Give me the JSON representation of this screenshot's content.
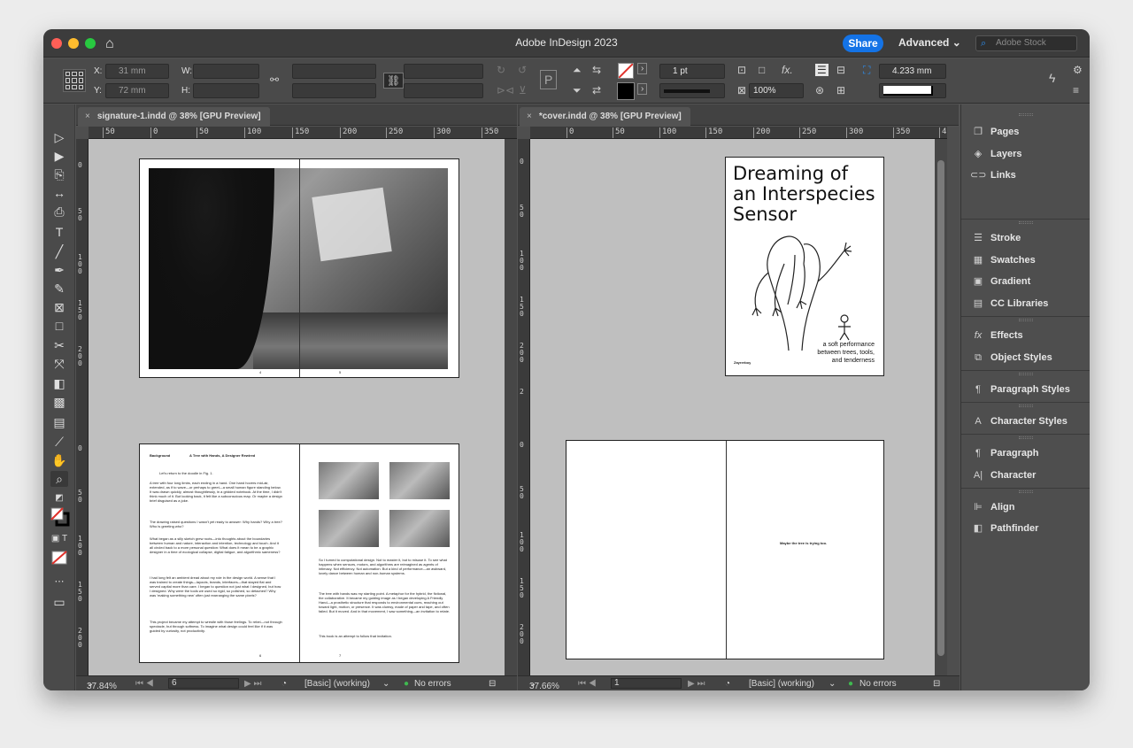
{
  "window": {
    "title": "Adobe InDesign 2023",
    "share_label": "Share",
    "workspace_label": "Advanced",
    "search_placeholder": "Adobe Stock"
  },
  "controlbar": {
    "x_label": "X:",
    "x_value": "31 mm",
    "y_label": "Y:",
    "y_value": "72 mm",
    "w_label": "W:",
    "h_label": "H:",
    "stroke_weight": "1 pt",
    "opacity": "100%",
    "offset": "4.233 mm",
    "p_glyph": "P",
    "fx_label": "fx."
  },
  "left_doc": {
    "tab_label": "signature-1.indd @ 38% [GPU Preview]",
    "ruler_h": [
      "50",
      "0",
      "50",
      "100",
      "150",
      "200",
      "250",
      "300",
      "350"
    ],
    "ruler_v": [
      "0",
      "50",
      "100",
      "150",
      "200",
      "0",
      "50",
      "100",
      "150",
      "200"
    ],
    "zoom": "37.84%",
    "page_number": "6",
    "style": "[Basic] (working)",
    "errors": "No errors",
    "spread2": {
      "header_left": "Background",
      "header_title": "A Tree with Hands, A Designer Rewired",
      "lead": "Let's return to the doodle in Fig. 1.",
      "p1": "A tree with four long limbs, each ending in a hand. One hand hovers mid-air, extended, as if to wave—or perhaps to greet—a small human figure standing below. It was drawn quickly, almost thoughtlessly, in a gridded notebook. At the time, I didn't think much of it. But looking back, it felt like a subconscious map. Or maybe a design brief disguised as a joke.",
      "p2": "The drawing raised questions I wasn't yet ready to answer: Why hands? Why a tree? Who is greeting who?",
      "p3": "What began as a silly sketch grew roots—into thoughts about the boundaries between human and nature, interaction and intention, technology and touch. And it all circled back to a more personal question: What does it mean to be a graphic designer in a time of ecological collapse, digital fatigue, and algorithmic sameness?",
      "p4": "I had long felt an ambient dread about my role in the design world. A sense that I was trained to create things—layouts, brands, interfaces—that stayed flat and served capital more than care. I began to question not just what I designed, but how I designed. Why were the tools we used so rigid, so polished, so detached? Why was 'making something new' often just rearranging the same pixels?",
      "p5": "This project became my attempt to wrestle with those feelings. To rebel—not through spectacle, but through softness. To imagine what design could feel like if it was guided by curiosity, not productivity.",
      "r1": "So I turned to computational design. Not to master it, but to misuse it. To see what happens when sensors, motors, and algorithms are reimagined as agents of intimacy. Not efficiency. Not automation. But a kind of performance—an awkward, lovely dance between human and non-human systems.",
      "r2": "The tree with hands was my starting point. A metaphor for the hybrid, the fictional, the collaborative. It became my guiding image as I began developing A Friendly Hand—a prosthetic structure that responds to environmental cues, reaching out toward light, motion, or presence. It was clumsy, made of paper and tape, and often failed. But it moved. And in that movement, I saw something—an invitation to relate.",
      "r3": "This book is an attempt to follow that invitation.",
      "folio_left": "6",
      "folio_right": "7"
    },
    "spread1": {
      "folio_left": "4",
      "folio_right": "5"
    }
  },
  "right_doc": {
    "tab_label": "*cover.indd @ 38% [GPU Preview]",
    "ruler_h": [
      "0",
      "50",
      "100",
      "150",
      "200",
      "250",
      "300",
      "350",
      "4"
    ],
    "ruler_v": [
      "0",
      "50",
      "100",
      "150",
      "200",
      "2",
      "0",
      "50",
      "100",
      "150",
      "200"
    ],
    "zoom": "37.66%",
    "page_number": "1",
    "style": "[Basic] (working)",
    "errors": "No errors",
    "cover": {
      "title_line1": "Dreaming of",
      "title_line2": "an Interspecies",
      "title_line3": "Sensor",
      "tagline1": "a soft performance",
      "tagline2": "between trees, tools,",
      "tagline3": "and tenderness",
      "author": "Zayrerboy"
    },
    "back_text": "Maybe the tree is trying too."
  },
  "panels": {
    "group1": [
      {
        "label": "Pages",
        "icon": "pages-icon",
        "glyph": "❐"
      },
      {
        "label": "Layers",
        "icon": "layers-icon",
        "glyph": "◈"
      },
      {
        "label": "Links",
        "icon": "links-icon",
        "glyph": "⊂⊃"
      }
    ],
    "group2": [
      {
        "label": "Stroke",
        "icon": "stroke-icon",
        "glyph": "☰"
      },
      {
        "label": "Swatches",
        "icon": "swatches-icon",
        "glyph": "▦"
      },
      {
        "label": "Gradient",
        "icon": "gradient-icon",
        "glyph": "▣"
      },
      {
        "label": "CC Libraries",
        "icon": "cc-libraries-icon",
        "glyph": "▤"
      }
    ],
    "group3": [
      {
        "label": "Effects",
        "icon": "effects-icon",
        "glyph": "fx"
      },
      {
        "label": "Object Styles",
        "icon": "object-styles-icon",
        "glyph": "⧉"
      }
    ],
    "group4": [
      {
        "label": "Paragraph Styles",
        "icon": "paragraph-styles-icon",
        "glyph": "¶"
      }
    ],
    "group5": [
      {
        "label": "Character Styles",
        "icon": "character-styles-icon",
        "glyph": "A"
      }
    ],
    "group6": [
      {
        "label": "Paragraph",
        "icon": "paragraph-icon",
        "glyph": "¶"
      },
      {
        "label": "Character",
        "icon": "character-icon",
        "glyph": "A|"
      }
    ],
    "group7": [
      {
        "label": "Align",
        "icon": "align-icon",
        "glyph": "⊫"
      },
      {
        "label": "Pathfinder",
        "icon": "pathfinder-icon",
        "glyph": "◧"
      }
    ]
  }
}
